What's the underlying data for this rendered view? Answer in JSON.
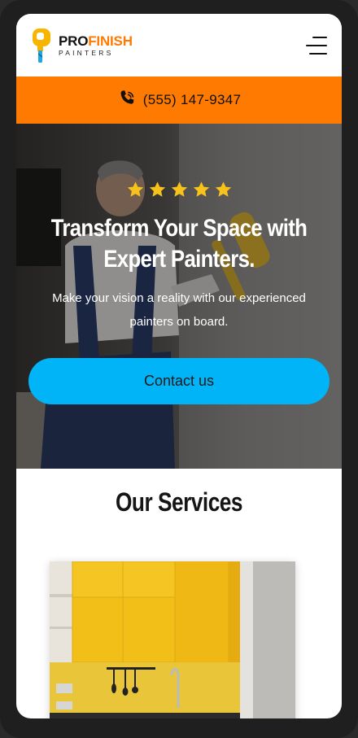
{
  "brand": {
    "name_part1": "PRO",
    "name_part2": "FINISH",
    "subtitle": "PAINTERS",
    "accent_color": "#ff7a00"
  },
  "header": {
    "menu_icon": "hamburger-menu-icon"
  },
  "phone_bar": {
    "icon": "phone-icon",
    "number": "(555) 147-9347",
    "bg_color": "#ff7a00"
  },
  "hero": {
    "rating_stars": 5,
    "star_color": "#f7c21b",
    "title": "Transform Your Space with Expert Painters.",
    "subtitle": "Make your vision a reality with our experienced painters on board.",
    "cta_label": "Contact us",
    "cta_color": "#00b4f7"
  },
  "services": {
    "title": "Our Services"
  }
}
